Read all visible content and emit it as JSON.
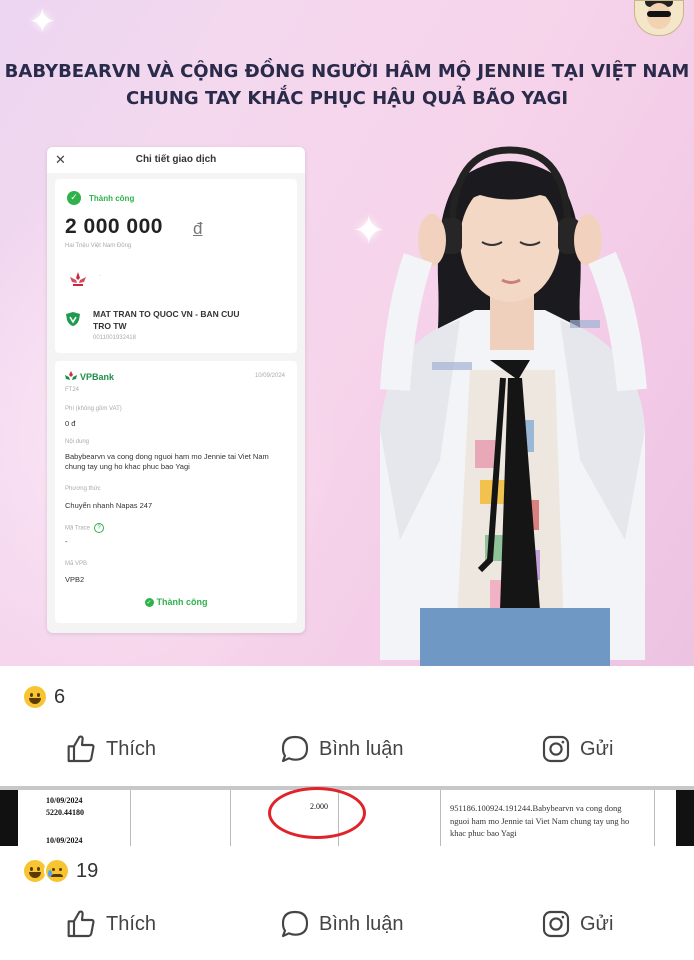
{
  "post": {
    "headline_line1": "BABYBEARVN VÀ CỘNG ĐỒNG NGƯỜI HÂM MỘ JENNIE TẠI VIỆT NAM",
    "headline_line2": "CHUNG TAY KHẮC PHỤC HẬU QUẢ BÃO YAGI"
  },
  "receipt": {
    "close_icon": "close-icon",
    "title": "Chi tiết giao dịch",
    "status": "Thành công",
    "amount": "2 000 000",
    "currency": "đ",
    "amount_words": "Hai Triệu Việt Nam Đồng",
    "sender_placeholder": "·",
    "recipient": "MAT TRAN TO QUOC VN - BAN CUU TRO TW",
    "account": "0011001932418",
    "bank_logo": "VPBank",
    "date": "10/09/2024",
    "ft": "FT24",
    "fee_label": "Phí (không gồm VAT)",
    "fee_value": "0 đ",
    "content_label": "Nội dung",
    "content_value": "Babybearvn va cong dong nguoi ham mo Jennie tai Viet Nam chung tay ung ho khac phuc bao Yagi",
    "method_label": "Phương thức",
    "method_value": "Chuyển nhanh Napas 247",
    "trace_label": "Mã Trace",
    "trace_value": "-",
    "vpb_label": "Mã VPB",
    "vpb_value": "VPB2",
    "footer_status": "Thành công"
  },
  "post1": {
    "reaction_count": "6",
    "like": "Thích",
    "comment": "Bình luận",
    "share": "Gửi"
  },
  "statement": {
    "date": "10/09/2024",
    "ref": "5220.44180",
    "date2": "10/09/2024",
    "amount": "2.000",
    "description": "951186.100924.191244.Babybearvn va cong dong nguoi ham mo Jennie tai Viet Nam chung tay ung ho khac phuc bao Yagi"
  },
  "post2": {
    "reaction_count": "19",
    "like": "Thích",
    "comment": "Bình luận",
    "share": "Gửi"
  },
  "colors": {
    "success_green": "#2fb24c",
    "highlight_red": "#e0232a",
    "headline": "#2a2a4a"
  }
}
